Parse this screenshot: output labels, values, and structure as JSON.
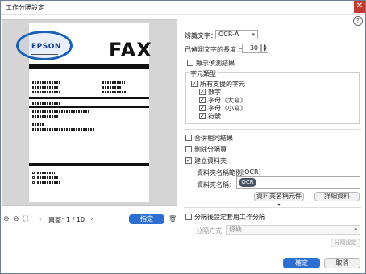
{
  "window": {
    "title": "工作分隔設定",
    "close_glyph": "✕"
  },
  "help_glyph": "?",
  "preview": {
    "logo_text": "EPSON",
    "header_text": "FAX",
    "toolbar": {
      "page_label": "頁面：",
      "page_value": "1 / 10",
      "designate_button": "指定",
      "zoom_in_glyph": "⊕",
      "zoom_out_glyph": "⊖",
      "fit_glyph": "⛶",
      "prev_glyph": "‹",
      "next_glyph": "›",
      "delete_glyph": "🗑"
    }
  },
  "settings": {
    "recognize_text_label": "辨識文字：",
    "recognize_text_value": "OCR-A",
    "max_length_label": "已偵測文字的長度上限：",
    "max_length_value": "30",
    "show_result_label": "顯示偵測結果",
    "char_type_group_label": "字元類型",
    "all_supported_label": "所有支援的字元",
    "char_types": [
      {
        "label": "數字",
        "checked": true
      },
      {
        "label": "字母（大寫）",
        "checked": true
      },
      {
        "label": "字母（小寫）",
        "checked": true
      },
      {
        "label": "符號",
        "checked": true
      }
    ],
    "merge_results_label": "合併相同結果",
    "delete_separator_label": "刪除分隔頁",
    "create_folder_label": "建立資料夾",
    "folder_example_label": "資料夾名稱範例：",
    "folder_example_value": "[OCR]",
    "folder_name_label": "資料夾名稱：",
    "folder_name_token": "OCR",
    "folder_name_elements_button": "資料夾名稱元件",
    "details_button": "詳細資料",
    "apply_to_separated_label": "分隔後設定套用工作分隔",
    "separate_method_label": "分隔方式",
    "separate_method_value": "條碼",
    "separate_settings_button": "分隔設定"
  },
  "footer": {
    "ok_button": "確定",
    "cancel_button": "取消"
  },
  "colors": {
    "accent": "#2c6fd1",
    "selection": "#1a60b6",
    "close": "#c23b32"
  }
}
